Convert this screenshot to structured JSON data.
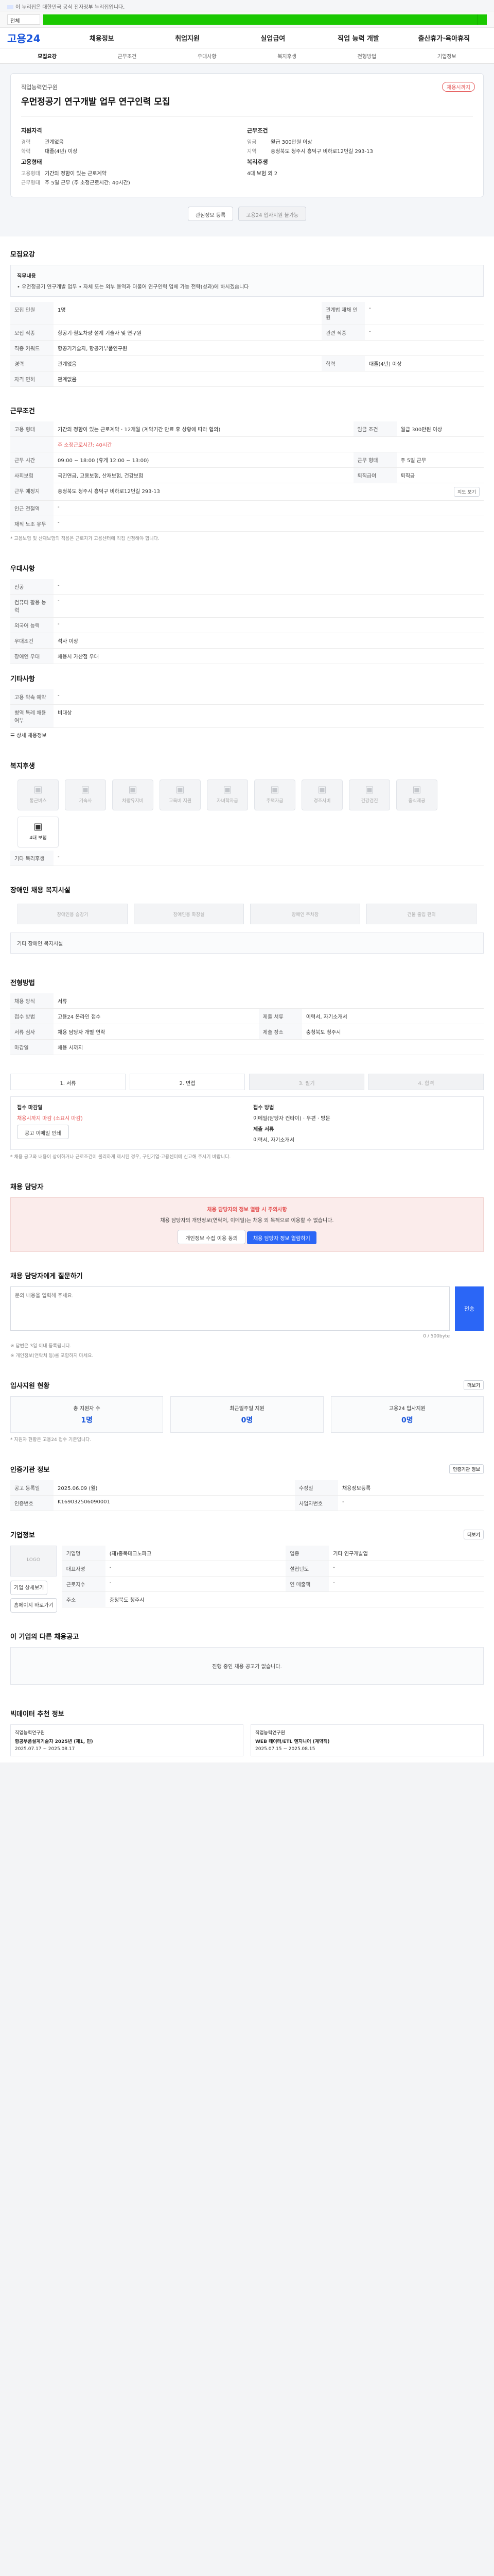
{
  "gov": {
    "notice": "이 누리집은 대한민국 공식 전자정부 누리집입니다."
  },
  "search": {
    "select": "전체",
    "label": "검색"
  },
  "nav": {
    "logo": "고용24",
    "menu": [
      "채용정보",
      "취업지원",
      "실업급여",
      "직업 능력 개발",
      "출산휴가·육아휴직"
    ]
  },
  "tabs": [
    "모집요강",
    "근무조건",
    "우대사항",
    "복지후생",
    "전형방법",
    "기업정보"
  ],
  "header": {
    "badge": "채용시까지",
    "company": "직업능력연구원",
    "title": "우먼정공기 연구개발 업무 연구인력 모집",
    "left_h": "지원자격",
    "left": [
      {
        "k": "경력",
        "v": "관계없음"
      },
      {
        "k": "학력",
        "v": "대졸(4년) 이상"
      }
    ],
    "right_h": "근무조건",
    "right": [
      {
        "k": "임금",
        "v": "월급 300만원 이상"
      },
      {
        "k": "지역",
        "v": "충청북도 청주시 흥덕구 비하로12번길 293-13"
      }
    ],
    "left2_h": "고용형태",
    "left2": [
      {
        "k": "고용형태",
        "v": "기간의 정함이 있는 근로계약"
      },
      {
        "k": "근무형태",
        "v": "주 5일 근무 (주 소정근로시간: 40시간)"
      }
    ],
    "right2_h": "복리후생",
    "right2": [
      {
        "k": "",
        "v": "4대 보험 외 2"
      }
    ],
    "save": "관심정보 등록",
    "apply": "고용24 입사지원 불가능"
  },
  "recruit": {
    "title": "모집요강",
    "job_h": "직무내용",
    "job": "• 우먼정공기 연구개발 업무 • 자체 또는 외부 용역과 더불어 연구인력 업체 가능 전략(성과)에 하시겠습니다",
    "rows": [
      {
        "k": "모집 인원",
        "v": "1명"
      },
      {
        "k": "관계법 재채 인원",
        "v": "-"
      },
      {
        "k": "모집 직종",
        "v": "항공기·철도차량 설계 기술자 및 연구원"
      },
      {
        "k": "관련 직종",
        "v": "-"
      },
      {
        "k": "직종 키워드",
        "v": "항공기기술자, 항공기부품연구원"
      },
      {
        "k": "경력",
        "v": "관계없음"
      },
      {
        "k": "학력",
        "v": "대졸(4년) 이상"
      },
      {
        "k": "자격 면허",
        "v": "관계없음"
      }
    ]
  },
  "work": {
    "title": "근무조건",
    "rows": [
      {
        "k": "고용 형태",
        "v": "기간의 정함이 있는 근로계약 · 12개월 (계약기간 만료 후 상황에 따라 협의)"
      },
      {
        "k": "임금 조건",
        "v": "월급 300만원 이상"
      },
      {
        "k": "근무 시간",
        "v": "09:00 ~ 18:00 (휴게 12:00 ~ 13:00)"
      },
      {
        "k": "근무 형태",
        "v": "주 5일 근무"
      },
      {
        "k": "사회보험",
        "v": "국민연금, 고용보험, 산재보험, 건강보험"
      },
      {
        "k": "퇴직급여",
        "v": "퇴직금"
      },
      {
        "k": "근무 예정지",
        "v": "충청북도 청주시 흥덕구 비하로12번길 293-13"
      },
      {
        "k": "인근 전철역",
        "v": "-"
      },
      {
        "k": "재직 노조 유무",
        "v": "-"
      }
    ],
    "hours": "주 소정근로시간: 40시간",
    "map_btn": "지도 보기",
    "note": "* 고용보험 및 산재보험의 적용은 근로자가 고용센터에 직접 신청해야 합니다."
  },
  "pref": {
    "title": "우대사항",
    "rows": [
      {
        "k": "전공",
        "v": "-"
      },
      {
        "k": "컴퓨터 활용 능력",
        "v": "-"
      },
      {
        "k": "외국어 능력",
        "v": "-"
      },
      {
        "k": "우대조건",
        "v": "석사 이상"
      },
      {
        "k": "장애인 우대",
        "v": "채용시 가산점 우대"
      }
    ],
    "others_h": "기타사항",
    "others": [
      {
        "k": "고용 약속 예약",
        "v": "-"
      },
      {
        "k": "병역 특례 채용 여부",
        "v": "비대상"
      }
    ],
    "more": "상세 채용정보"
  },
  "welfare": {
    "title": "복지후생",
    "items": [
      "통근버스",
      "기숙사",
      "차량유지비",
      "교육비 지원",
      "자녀학자금",
      "주택자금",
      "경조사비",
      "건강검진",
      "중식제공",
      "4대 보험"
    ],
    "others_h": "기타 복리후생",
    "others": "-"
  },
  "disabled": {
    "title": "장애인 채용 복지시설",
    "items": [
      "장애인용 승강기",
      "장애인용 화장실",
      "장애인 주차장",
      "건물 출입 편의"
    ],
    "note": "기타 장애인 복지시설"
  },
  "process": {
    "title": "전형방법",
    "rows": [
      {
        "k": "채용 방식",
        "v": "서류"
      },
      {
        "k": "접수 방법",
        "v": "고용24 온라인 접수"
      },
      {
        "k": "제출 서류",
        "v": "이력서, 자기소개서"
      },
      {
        "k": "서류 심사",
        "v": "채용 담당자 개별 연락"
      },
      {
        "k": "제출 장소",
        "v": "충청북도 청주시"
      },
      {
        "k": "마감일",
        "v": "채용 시까지"
      }
    ],
    "steps": [
      "1. 서류",
      "2. 면접",
      "3. 필기",
      "4. 합격"
    ],
    "hbox_l": "접수 마감일",
    "hbox_l2": "채용시까지 마감 (소요시 마감)",
    "hbox_r": "접수 방법",
    "hbox_r2": "이메일(담당자 컨타이) · 우편 · 방문",
    "cal": "공고 이메일 인쇄",
    "hbox_r3": "제출 서류",
    "hbox_r4": "이력서, 자기소개서",
    "foot_note": "* 채용 공고와 내용이 상이하거나 근로조건이 불리하게 제시된 경우, 구인기업·고용센터에 신고해 주시기 바랍니다."
  },
  "contact": {
    "title": "채용 담당자",
    "box": "채용 담당자의 정보 열람 시 주의사항",
    "box2": "채용 담당자의 개인정보(연락처, 이메일)는 채용 외 목적으로 이용할 수 없습니다.",
    "btn1": "개인정보 수집 이용 동의",
    "btn2": "채용 담당자 정보 열람하기"
  },
  "question": {
    "title": "채용 담당자에게 질문하기",
    "placeholder": "문의 내용을 입력해 주세요.",
    "counter": "0 / 500byte",
    "send": "전송",
    "notes": [
      "※ 답변은 3일 이내 등록됩니다.",
      "※ 개인정보(연락처 등)를 포함하지 마세요."
    ]
  },
  "status": {
    "title": "입사지원 현황",
    "more": "더보기",
    "cards": [
      {
        "k": "총 지원자 수",
        "v": "1명"
      },
      {
        "k": "최근일주일 지원",
        "v": "0명"
      },
      {
        "k": "고용24 입사지원",
        "v": "0명"
      }
    ],
    "note": "* 지원자 현황은 고용24 접수 기준입니다."
  },
  "info": {
    "title": "인증기관 정보",
    "rows": [
      {
        "k": "공고 등록일",
        "v": "2025.06.09 (월)"
      },
      {
        "k": "수정일",
        "v": "채용정보등록"
      },
      {
        "k": "인증번호",
        "v": "K169032506090001"
      },
      {
        "k": "사업자번호",
        "v": "-"
      }
    ],
    "btn": "인증기관 정보"
  },
  "company": {
    "title": "기업정보",
    "more": "더보기",
    "logo": "LOGO",
    "rows": [
      {
        "k": "기업명",
        "v": "(재)충북테크노파크"
      },
      {
        "k": "업종",
        "v": "기타 연구개발업"
      },
      {
        "k": "대표자명",
        "v": "-"
      },
      {
        "k": "설립년도",
        "v": "-"
      },
      {
        "k": "근로자수",
        "v": "-"
      },
      {
        "k": "연 매출액",
        "v": "-"
      },
      {
        "k": "주소",
        "v": "충청북도 청주시"
      }
    ],
    "btn1": "기업 상세보기",
    "btn2": "홈페이지 바로가기"
  },
  "same": {
    "title": "이 기업의 다른 채용공고",
    "empty": "진행 중인 채용 공고가 없습니다."
  },
  "recommend": {
    "title": "빅데이터 추천 정보",
    "items": [
      {
        "co": "직업능력연구원",
        "t": "항공부품설계기술자 2025년 (제1, 민)",
        "d": "2025.07.17 ~ 2025.08.17"
      },
      {
        "co": "직업능력연구원",
        "t": "WEB 데이터/ETL 엔지니어 (계약직)",
        "d": "2025.07.15 ~ 2025.08.15"
      }
    ]
  }
}
